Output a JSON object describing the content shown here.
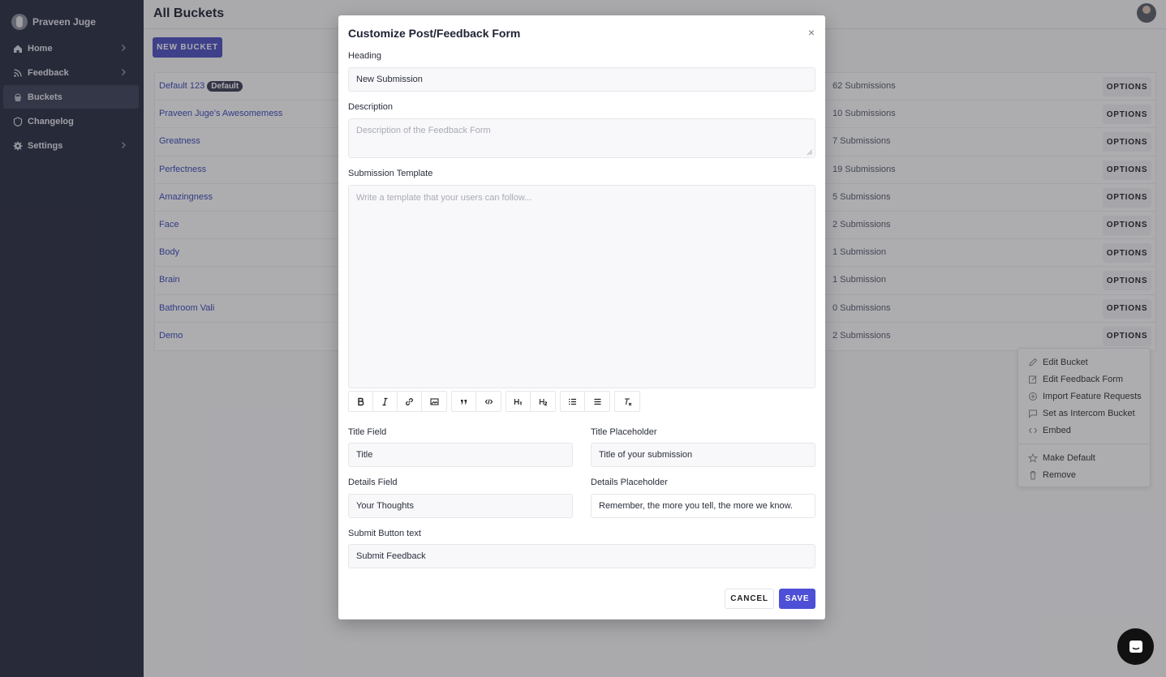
{
  "sidebar": {
    "brand": "Praveen Juge",
    "items": [
      {
        "label": "Home",
        "icon": "home-icon",
        "has_chevron": true
      },
      {
        "label": "Feedback",
        "icon": "rss-icon",
        "has_chevron": true
      },
      {
        "label": "Buckets",
        "icon": "bucket-icon",
        "has_chevron": false,
        "active": true
      },
      {
        "label": "Changelog",
        "icon": "changelog-icon",
        "has_chevron": false
      },
      {
        "label": "Settings",
        "icon": "gear-icon",
        "has_chevron": true
      }
    ]
  },
  "header": {
    "title": "All Buckets"
  },
  "toolbar": {
    "new_bucket_label": "NEW BUCKET"
  },
  "buckets": [
    {
      "name": "Default 123",
      "badge": "Default",
      "count": "62 Submissions",
      "options": "OPTIONS"
    },
    {
      "name": "Praveen Juge's Awesomemess",
      "count": "10 Submissions",
      "options": "OPTIONS"
    },
    {
      "name": "Greatness",
      "count": "7 Submissions",
      "options": "OPTIONS"
    },
    {
      "name": "Perfectness",
      "count": "19 Submissions",
      "options": "OPTIONS"
    },
    {
      "name": "Amazingness",
      "count": "5 Submissions",
      "options": "OPTIONS"
    },
    {
      "name": "Face",
      "count": "2 Submissions",
      "options": "OPTIONS"
    },
    {
      "name": "Body",
      "count": "1 Submission",
      "options": "OPTIONS"
    },
    {
      "name": "Brain",
      "count": "1 Submission",
      "options": "OPTIONS"
    },
    {
      "name": "Bathroom Vali",
      "count": "0 Submissions",
      "options": "OPTIONS"
    },
    {
      "name": "Demo",
      "count": "2 Submissions",
      "options": "OPTIONS"
    }
  ],
  "options_menu": {
    "items": [
      "Edit Bucket",
      "Edit Feedback Form",
      "Import Feature Requests",
      "Set as Intercom Bucket",
      "Embed"
    ],
    "items2": [
      "Make Default",
      "Remove"
    ]
  },
  "modal": {
    "title": "Customize Post/Feedback Form",
    "heading_label": "Heading",
    "heading_value": "New Submission",
    "description_label": "Description",
    "description_placeholder": "Description of the Feedback Form",
    "template_label": "Submission Template",
    "template_placeholder": "Write a template that your users can follow...",
    "title_field_label": "Title Field",
    "title_field_value": "Title",
    "title_placeholder_label": "Title Placeholder",
    "title_placeholder_value": "Title of your submission",
    "details_field_label": "Details Field",
    "details_field_value": "Your Thoughts",
    "details_placeholder_label": "Details Placeholder",
    "details_placeholder_value": "Remember, the more you tell, the more we know.",
    "submit_label": "Submit Button text",
    "submit_value": "Submit Feedback",
    "cancel_label": "CANCEL",
    "save_label": "SAVE",
    "close_glyph": "×"
  },
  "colors": {
    "sidebar_bg": "#282c3f",
    "accent": "#4d4fd6",
    "link": "#3b48b5"
  }
}
